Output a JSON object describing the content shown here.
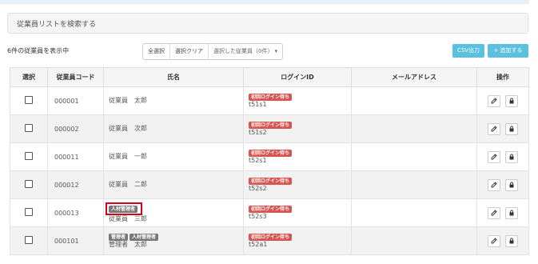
{
  "search_panel": {
    "title": "従業員リストを検索する"
  },
  "toolbar": {
    "count_text": "6件の従業員を表示中",
    "select_all": "全選択",
    "clear_selection": "選択クリア",
    "selected_employees": "選択した従業員（0件） ▾",
    "csv_button": "CSV出力",
    "add_button": "+ 追加する"
  },
  "table": {
    "headers": {
      "select": "選択",
      "code": "従業員コード",
      "name": "氏名",
      "login_id": "ログインID",
      "email": "メールアドレス",
      "actions": "操作"
    },
    "rows": [
      {
        "code": "000001",
        "badges": [],
        "name": "従業員　太郎",
        "status": "初回ログイン待ち",
        "login": "t51s1",
        "email": ""
      },
      {
        "code": "000002",
        "badges": [],
        "name": "従業員　次郎",
        "status": "初回ログイン待ち",
        "login": "t51s2",
        "email": ""
      },
      {
        "code": "000011",
        "badges": [],
        "name": "従業員　一郎",
        "status": "初回ログイン待ち",
        "login": "t52s1",
        "email": ""
      },
      {
        "code": "000012",
        "badges": [],
        "name": "従業員　二郎",
        "status": "初回ログイン待ち",
        "login": "t52s2",
        "email": ""
      },
      {
        "code": "000013",
        "badges": [
          "人材管理者"
        ],
        "name": "従業員　三郎",
        "status": "初回ログイン待ち",
        "login": "t52s3",
        "email": ""
      },
      {
        "code": "000101",
        "badges": [
          "管理者",
          "人材管理者"
        ],
        "name": "管理者　太郎",
        "status": "初回ログイン待ち",
        "login": "t52a1",
        "email": ""
      }
    ]
  },
  "colors": {
    "accent": "#5bc0de",
    "status_badge": "#d9534f",
    "role_badge": "#777777",
    "highlight": "#d9001b"
  },
  "icons": {
    "edit": "edit-icon",
    "lock": "lock-icon"
  }
}
